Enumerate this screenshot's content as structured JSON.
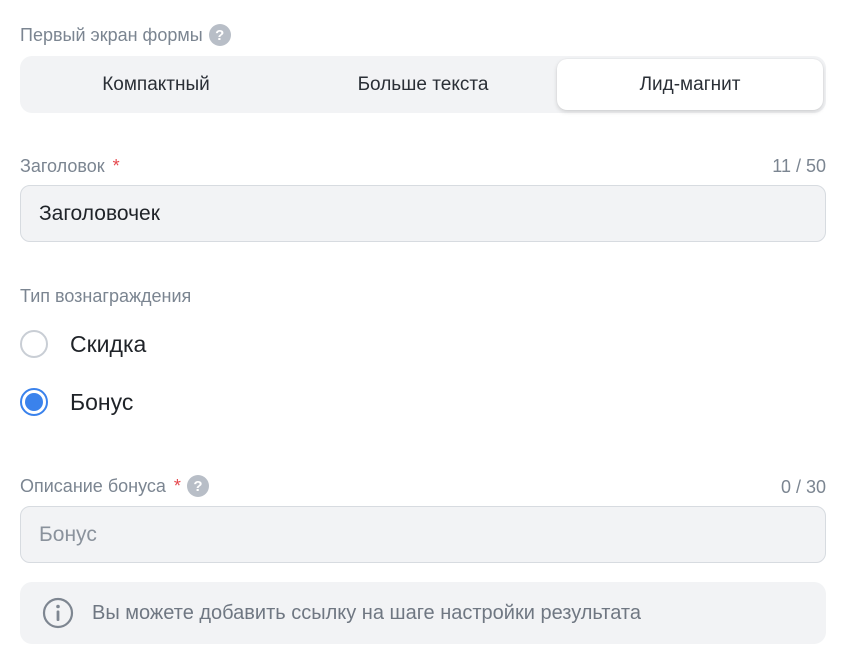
{
  "first_screen": {
    "label": "Первый экран формы",
    "options": [
      "Компактный",
      "Больше текста",
      "Лид-магнит"
    ],
    "selected": "Лид-магнит"
  },
  "title_field": {
    "label": "Заголовок",
    "required_mark": "*",
    "counter": "11 / 50",
    "value": "Заголовочек"
  },
  "reward_type": {
    "label": "Тип вознаграждения",
    "options": [
      {
        "label": "Скидка",
        "checked": false
      },
      {
        "label": "Бонус",
        "checked": true
      }
    ]
  },
  "bonus_description": {
    "label": "Описание бонуса",
    "required_mark": "*",
    "counter": "0 / 30",
    "value": "",
    "placeholder": "Бонус"
  },
  "info": {
    "text": "Вы можете добавить ссылку на шаге настройки результата"
  },
  "colors": {
    "accent": "#3a82ec",
    "required": "#e5484d",
    "muted_text": "#7b8591",
    "field_bg": "#f2f3f5"
  },
  "icons": {
    "help": "question-circle",
    "info": "info-circle"
  }
}
